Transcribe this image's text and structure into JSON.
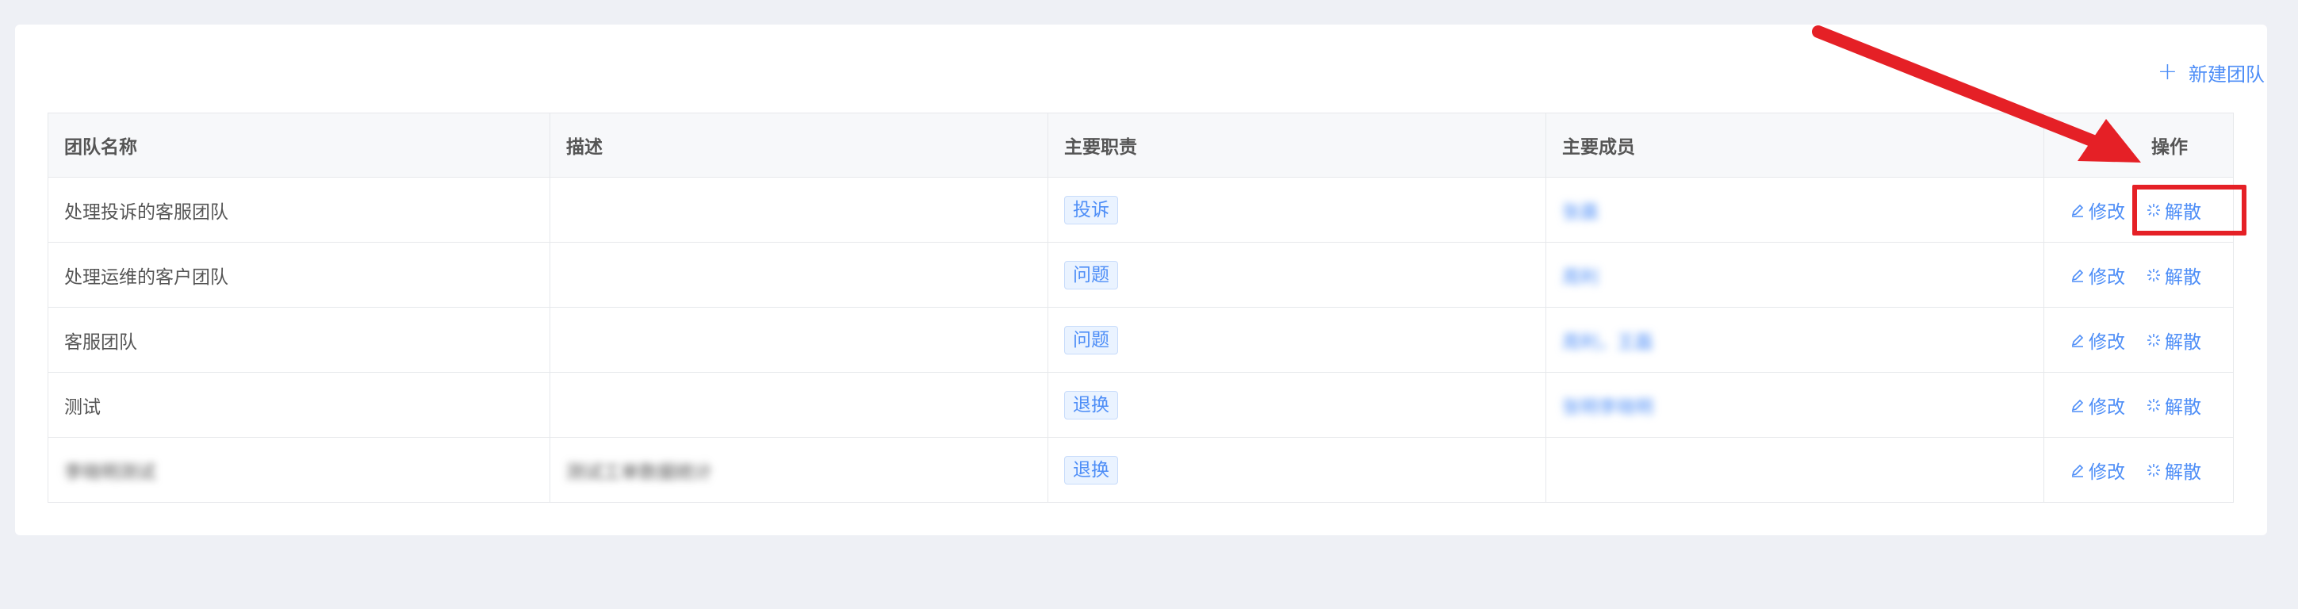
{
  "toolbar": {
    "new_team_label": "新建团队"
  },
  "table": {
    "headers": [
      "团队名称",
      "描述",
      "主要职责",
      "主要成员",
      "操作"
    ],
    "rows": [
      {
        "name": "处理投诉的客服团队",
        "description": "",
        "duty": "投诉",
        "members": "张晨"
      },
      {
        "name": "处理运维的客户团队",
        "description": "",
        "duty": "问题",
        "members": "周利"
      },
      {
        "name": "客服团队",
        "description": "",
        "duty": "问题",
        "members": "周利，王磊"
      },
      {
        "name": "测试",
        "description": "",
        "duty": "退换",
        "members": "张明李晓明"
      },
      {
        "name": "李晓明测试",
        "description": "测试工单数据统计",
        "duty": "退换",
        "members": ""
      }
    ],
    "actions": {
      "edit": "修改",
      "dissolve": "解散"
    }
  },
  "colors": {
    "accent": "#4e8ef7",
    "annotation": "#e52026"
  }
}
